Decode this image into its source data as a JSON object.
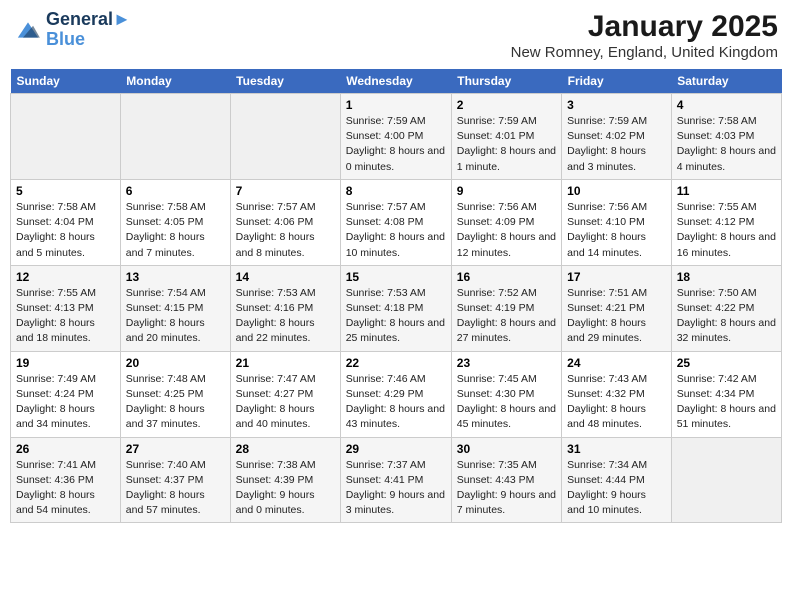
{
  "logo": {
    "line1": "General",
    "line2": "Blue"
  },
  "title": "January 2025",
  "subtitle": "New Romney, England, United Kingdom",
  "days_header": [
    "Sunday",
    "Monday",
    "Tuesday",
    "Wednesday",
    "Thursday",
    "Friday",
    "Saturday"
  ],
  "weeks": [
    [
      {
        "num": "",
        "text": ""
      },
      {
        "num": "",
        "text": ""
      },
      {
        "num": "",
        "text": ""
      },
      {
        "num": "1",
        "text": "Sunrise: 7:59 AM\nSunset: 4:00 PM\nDaylight: 8 hours and 0 minutes."
      },
      {
        "num": "2",
        "text": "Sunrise: 7:59 AM\nSunset: 4:01 PM\nDaylight: 8 hours and 1 minute."
      },
      {
        "num": "3",
        "text": "Sunrise: 7:59 AM\nSunset: 4:02 PM\nDaylight: 8 hours and 3 minutes."
      },
      {
        "num": "4",
        "text": "Sunrise: 7:58 AM\nSunset: 4:03 PM\nDaylight: 8 hours and 4 minutes."
      }
    ],
    [
      {
        "num": "5",
        "text": "Sunrise: 7:58 AM\nSunset: 4:04 PM\nDaylight: 8 hours and 5 minutes."
      },
      {
        "num": "6",
        "text": "Sunrise: 7:58 AM\nSunset: 4:05 PM\nDaylight: 8 hours and 7 minutes."
      },
      {
        "num": "7",
        "text": "Sunrise: 7:57 AM\nSunset: 4:06 PM\nDaylight: 8 hours and 8 minutes."
      },
      {
        "num": "8",
        "text": "Sunrise: 7:57 AM\nSunset: 4:08 PM\nDaylight: 8 hours and 10 minutes."
      },
      {
        "num": "9",
        "text": "Sunrise: 7:56 AM\nSunset: 4:09 PM\nDaylight: 8 hours and 12 minutes."
      },
      {
        "num": "10",
        "text": "Sunrise: 7:56 AM\nSunset: 4:10 PM\nDaylight: 8 hours and 14 minutes."
      },
      {
        "num": "11",
        "text": "Sunrise: 7:55 AM\nSunset: 4:12 PM\nDaylight: 8 hours and 16 minutes."
      }
    ],
    [
      {
        "num": "12",
        "text": "Sunrise: 7:55 AM\nSunset: 4:13 PM\nDaylight: 8 hours and 18 minutes."
      },
      {
        "num": "13",
        "text": "Sunrise: 7:54 AM\nSunset: 4:15 PM\nDaylight: 8 hours and 20 minutes."
      },
      {
        "num": "14",
        "text": "Sunrise: 7:53 AM\nSunset: 4:16 PM\nDaylight: 8 hours and 22 minutes."
      },
      {
        "num": "15",
        "text": "Sunrise: 7:53 AM\nSunset: 4:18 PM\nDaylight: 8 hours and 25 minutes."
      },
      {
        "num": "16",
        "text": "Sunrise: 7:52 AM\nSunset: 4:19 PM\nDaylight: 8 hours and 27 minutes."
      },
      {
        "num": "17",
        "text": "Sunrise: 7:51 AM\nSunset: 4:21 PM\nDaylight: 8 hours and 29 minutes."
      },
      {
        "num": "18",
        "text": "Sunrise: 7:50 AM\nSunset: 4:22 PM\nDaylight: 8 hours and 32 minutes."
      }
    ],
    [
      {
        "num": "19",
        "text": "Sunrise: 7:49 AM\nSunset: 4:24 PM\nDaylight: 8 hours and 34 minutes."
      },
      {
        "num": "20",
        "text": "Sunrise: 7:48 AM\nSunset: 4:25 PM\nDaylight: 8 hours and 37 minutes."
      },
      {
        "num": "21",
        "text": "Sunrise: 7:47 AM\nSunset: 4:27 PM\nDaylight: 8 hours and 40 minutes."
      },
      {
        "num": "22",
        "text": "Sunrise: 7:46 AM\nSunset: 4:29 PM\nDaylight: 8 hours and 43 minutes."
      },
      {
        "num": "23",
        "text": "Sunrise: 7:45 AM\nSunset: 4:30 PM\nDaylight: 8 hours and 45 minutes."
      },
      {
        "num": "24",
        "text": "Sunrise: 7:43 AM\nSunset: 4:32 PM\nDaylight: 8 hours and 48 minutes."
      },
      {
        "num": "25",
        "text": "Sunrise: 7:42 AM\nSunset: 4:34 PM\nDaylight: 8 hours and 51 minutes."
      }
    ],
    [
      {
        "num": "26",
        "text": "Sunrise: 7:41 AM\nSunset: 4:36 PM\nDaylight: 8 hours and 54 minutes."
      },
      {
        "num": "27",
        "text": "Sunrise: 7:40 AM\nSunset: 4:37 PM\nDaylight: 8 hours and 57 minutes."
      },
      {
        "num": "28",
        "text": "Sunrise: 7:38 AM\nSunset: 4:39 PM\nDaylight: 9 hours and 0 minutes."
      },
      {
        "num": "29",
        "text": "Sunrise: 7:37 AM\nSunset: 4:41 PM\nDaylight: 9 hours and 3 minutes."
      },
      {
        "num": "30",
        "text": "Sunrise: 7:35 AM\nSunset: 4:43 PM\nDaylight: 9 hours and 7 minutes."
      },
      {
        "num": "31",
        "text": "Sunrise: 7:34 AM\nSunset: 4:44 PM\nDaylight: 9 hours and 10 minutes."
      },
      {
        "num": "",
        "text": ""
      }
    ]
  ],
  "colors": {
    "header_bg": "#3a6abf",
    "header_text": "#ffffff",
    "odd_row": "#f5f5f5",
    "even_row": "#ffffff",
    "empty_cell": "#f0f0f0"
  }
}
